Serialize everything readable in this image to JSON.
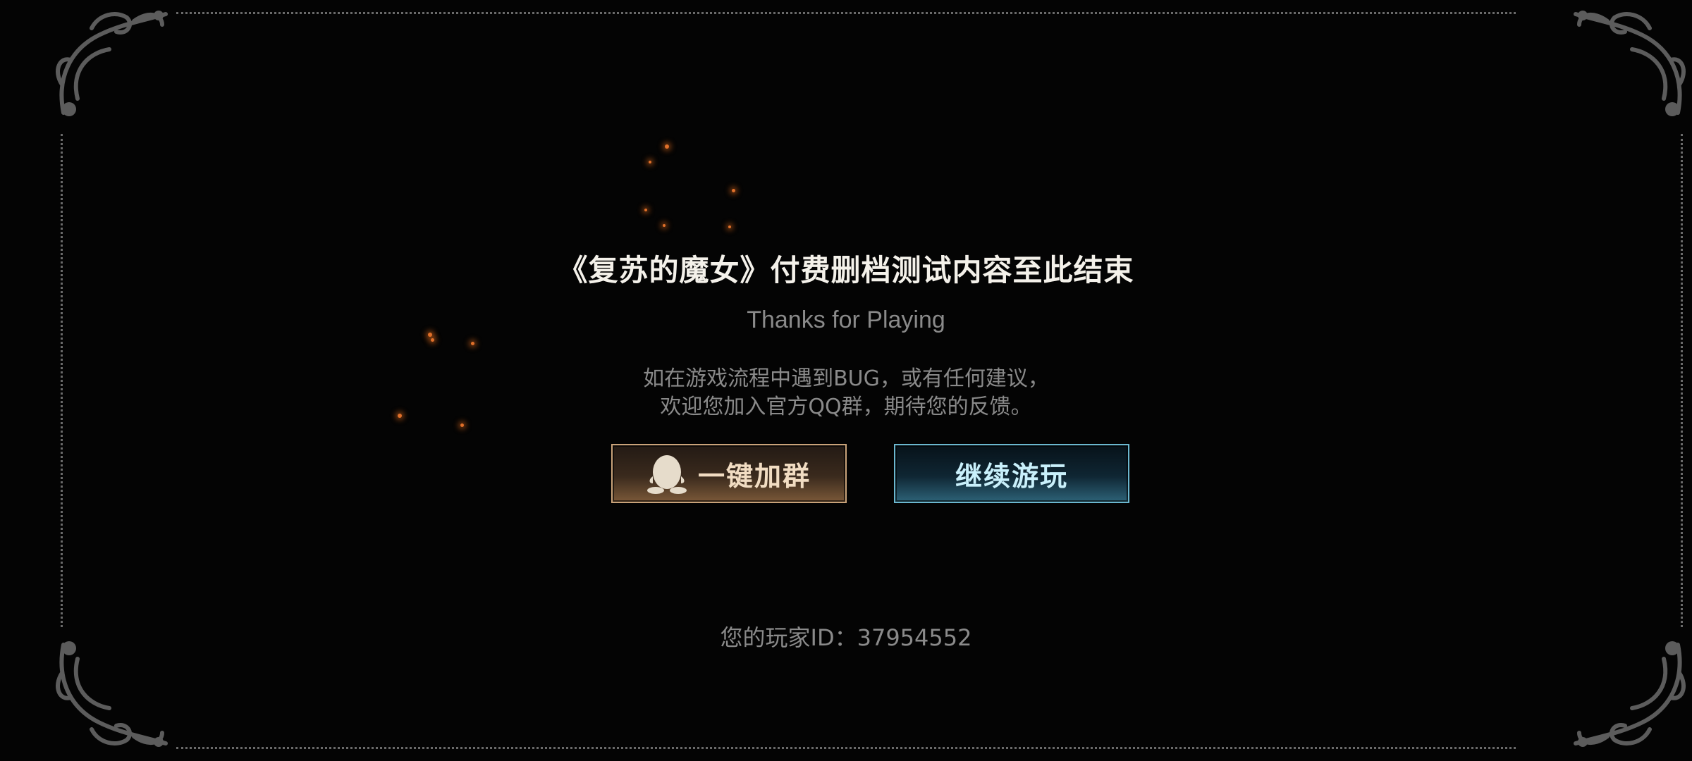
{
  "dialog": {
    "title": "《复苏的魔女》付费删档测试内容至此结束",
    "subtitle": "Thanks for Playing",
    "message_line1": "如在游戏流程中遇到BUG，或有任何建议，",
    "message_line2": "欢迎您加入官方QQ群，期待您的反馈。"
  },
  "buttons": {
    "join_group": {
      "label": "一键加群",
      "icon": "qq-penguin-icon"
    },
    "continue_playing": {
      "label": "继续游玩"
    }
  },
  "footer": {
    "player_id": "您的玩家ID：37954552"
  },
  "colors": {
    "background": "#040404",
    "join_border": "#c9a37a",
    "continue_border": "#6bb7cf",
    "ember": "#e0702a"
  }
}
